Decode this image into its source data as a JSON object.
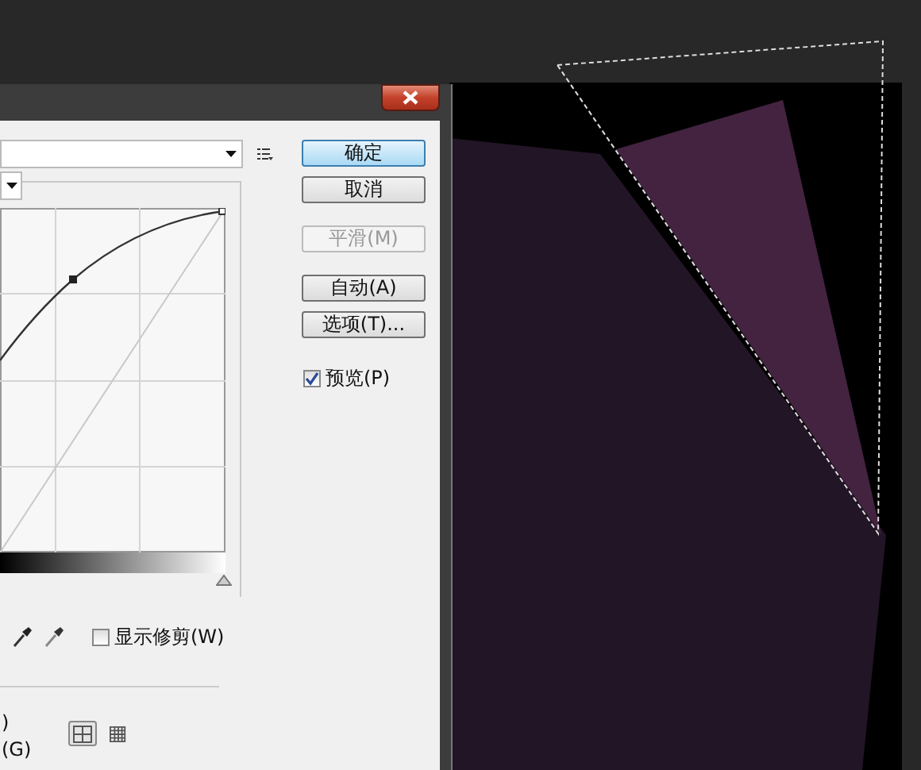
{
  "dialog": {
    "buttons": [
      {
        "label": "确定",
        "kind": "default",
        "disabled": false
      },
      {
        "label": "取消",
        "kind": "plain",
        "disabled": false
      },
      {
        "label": "平滑(M)",
        "kind": "plain",
        "disabled": true
      },
      {
        "label": "自动(A)",
        "kind": "plain",
        "disabled": false
      },
      {
        "label": "选项(T)...",
        "kind": "plain",
        "disabled": false
      }
    ],
    "preview": {
      "label": "预览(P)",
      "checked": true
    },
    "show_clipping": {
      "label": "显示修剪(W)",
      "checked": false
    },
    "cut_labels": [
      ")",
      "(G)"
    ],
    "grid_options": [
      {
        "selected": true
      },
      {
        "selected": false
      }
    ]
  }
}
